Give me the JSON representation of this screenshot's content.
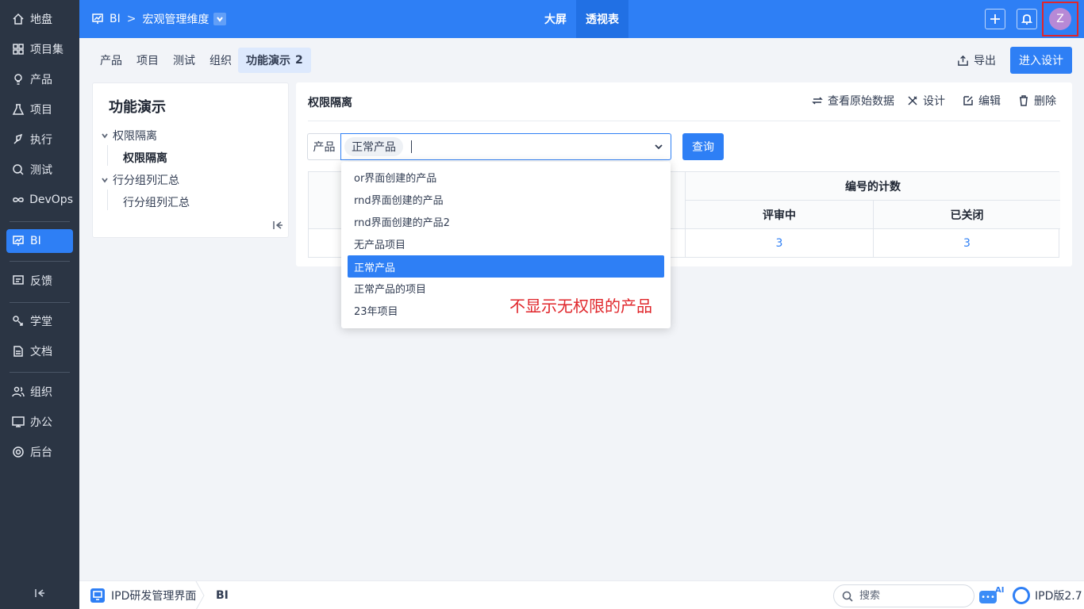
{
  "sidebar": {
    "items": [
      {
        "label": "地盘",
        "icon": "home-icon"
      },
      {
        "label": "项目集",
        "icon": "grid-icon"
      },
      {
        "label": "产品",
        "icon": "bulb-icon"
      },
      {
        "label": "项目",
        "icon": "flask-icon"
      },
      {
        "label": "执行",
        "icon": "rocket-icon"
      },
      {
        "label": "测试",
        "icon": "search-icon"
      },
      {
        "label": "DevOps",
        "icon": "infinity-icon"
      },
      {
        "label": "BI",
        "icon": "chart-icon"
      },
      {
        "label": "反馈",
        "icon": "feedback-icon"
      },
      {
        "label": "学堂",
        "icon": "school-icon"
      },
      {
        "label": "文档",
        "icon": "document-icon"
      },
      {
        "label": "组织",
        "icon": "users-icon"
      },
      {
        "label": "办公",
        "icon": "office-icon"
      },
      {
        "label": "后台",
        "icon": "gear-icon"
      }
    ],
    "active": "BI"
  },
  "header": {
    "module": "BI",
    "dimension": "宏观管理维度",
    "tabs": [
      "大屏",
      "透视表"
    ],
    "active_tab": "透视表",
    "avatar_letter": "Z"
  },
  "subnav": {
    "tabs": [
      "产品",
      "项目",
      "测试",
      "组织",
      "功能演示"
    ],
    "active_badge": "2",
    "export_label": "导出",
    "design_label": "进入设计"
  },
  "tree": {
    "title": "功能演示",
    "groups": [
      {
        "label": "权限隔离",
        "child": "权限隔离"
      },
      {
        "label": "行分组列汇总",
        "child": "行分组列汇总"
      }
    ]
  },
  "main": {
    "title": "权限隔离",
    "actions": [
      "查看原始数据",
      "设计",
      "编辑",
      "删除"
    ],
    "filter_label": "产品",
    "selected_chip": "正常产品",
    "query_label": "查询",
    "table": {
      "group_header": "编号的计数",
      "columns": [
        "评审中",
        "已关闭"
      ],
      "values": [
        "3",
        "3"
      ]
    }
  },
  "dropdown": {
    "options": [
      "or界面创建的产品",
      "rnd界面创建的产品",
      "rnd界面创建的产品2",
      "无产品项目",
      "正常产品",
      "正常产品的项目",
      "23年项目"
    ],
    "selected": "正常产品",
    "annotation": "不显示无权限的产品"
  },
  "footer": {
    "app_name": "IPD研发管理界面",
    "current": "BI",
    "search_placeholder": "搜索",
    "ai_label": "AI",
    "version": "IPD版2.7"
  },
  "colors": {
    "primary": "#2e7ff5",
    "sidebar_bg": "#2b3544",
    "annotation_red": "#e0262b"
  }
}
